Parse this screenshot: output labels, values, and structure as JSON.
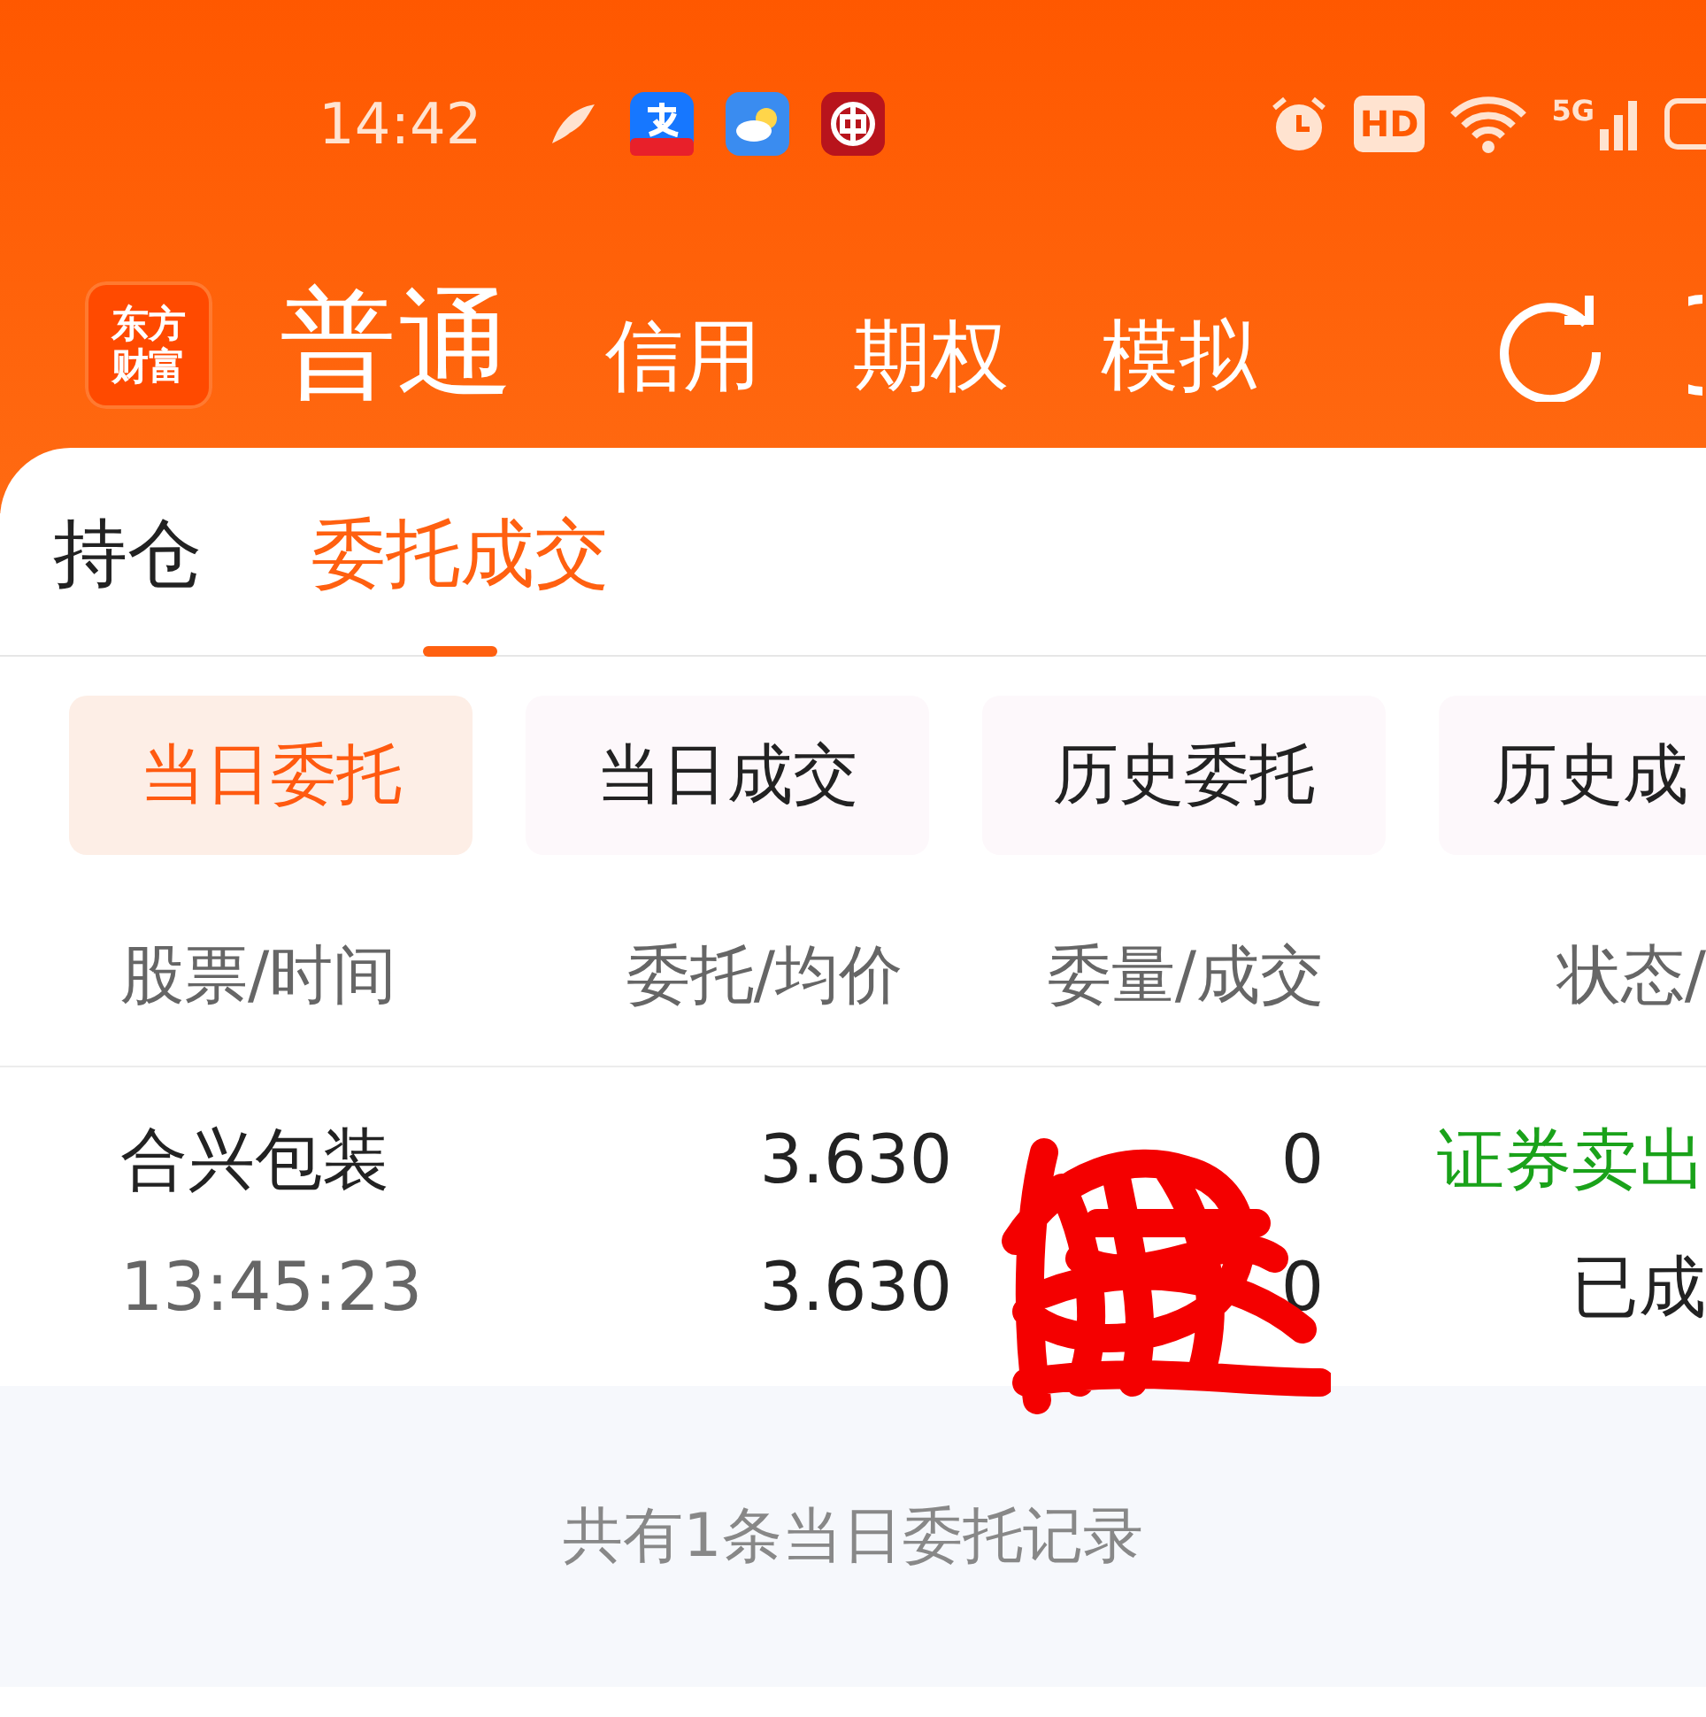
{
  "status_bar": {
    "time": "14:42",
    "hd_label": "HD",
    "network_label": "5G"
  },
  "app_bar": {
    "logo_lines": [
      "东方",
      "财富"
    ],
    "modes": [
      {
        "label": "普通",
        "selected": true
      },
      {
        "label": "信用",
        "selected": false
      },
      {
        "label": "期权",
        "selected": false
      },
      {
        "label": "模拟",
        "selected": false
      }
    ]
  },
  "tabs": [
    {
      "label": "持仓",
      "selected": false
    },
    {
      "label": "委托成交",
      "selected": true
    }
  ],
  "filters": [
    {
      "label": "当日委托",
      "selected": true
    },
    {
      "label": "当日成交",
      "selected": false
    },
    {
      "label": "历史委托",
      "selected": false
    },
    {
      "label": "历史成",
      "selected": false
    }
  ],
  "table": {
    "columns": [
      "股票/时间",
      "委托/均价",
      "委量/成交",
      "状态/"
    ],
    "rows": [
      {
        "stock": "合兴包装",
        "time": "13:45:23",
        "order_price": "3.630",
        "avg_price": "3.630",
        "order_qty": "0",
        "filled_qty": "0",
        "direction": "证券卖出",
        "kind": "sell",
        "status": "已成"
      }
    ]
  },
  "footer": "共有1条当日委托记录"
}
